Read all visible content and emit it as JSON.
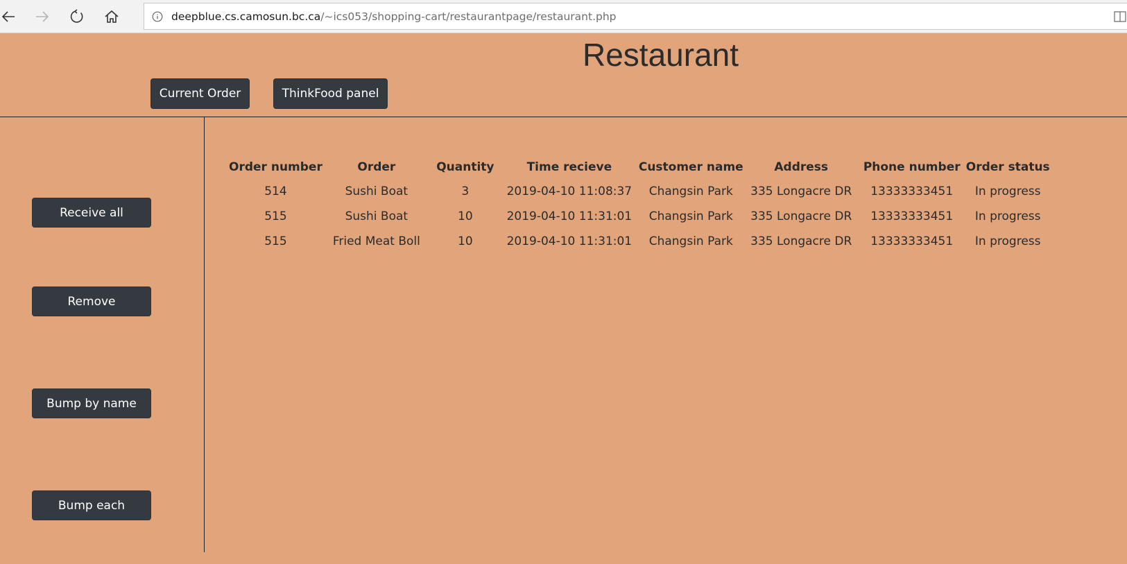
{
  "browser": {
    "url_domain": "deepblue.cs.camosun.bc.ca",
    "url_path": "/~ics053/shopping-cart/restaurantpage/restaurant.php",
    "icons": [
      "back-arrow-icon",
      "forward-arrow-icon",
      "refresh-icon",
      "home-icon",
      "info-icon",
      "reading-view-icon"
    ]
  },
  "header": {
    "title": "Restaurant",
    "current_order_label": "Current Order",
    "thinkfood_panel_label": "ThinkFood panel"
  },
  "sidebar": {
    "receive_all_label": "Receive all",
    "remove_label": "Remove",
    "bump_by_name_label": "Bump by name",
    "bump_each_label": "Bump each"
  },
  "table": {
    "headers": [
      "Order number",
      "Order",
      "Quantity",
      "Time recieve",
      "Customer name",
      "Address",
      "Phone number",
      "Order status"
    ],
    "rows": [
      [
        "514",
        "Sushi Boat",
        "3",
        "2019-04-10 11:08:37",
        "Changsin Park",
        "335 Longacre DR",
        "13333333451",
        "In progress"
      ],
      [
        "515",
        "Sushi Boat",
        "10",
        "2019-04-10 11:31:01",
        "Changsin Park",
        "335 Longacre DR",
        "13333333451",
        "In progress"
      ],
      [
        "515",
        "Fried Meat Boll",
        "10",
        "2019-04-10 11:31:01",
        "Changsin Park",
        "335 Longacre DR",
        "13333333451",
        "In progress"
      ]
    ]
  },
  "colors": {
    "page_background": "#e2a47b",
    "button_background": "#343a40",
    "button_text": "#ffffff"
  }
}
